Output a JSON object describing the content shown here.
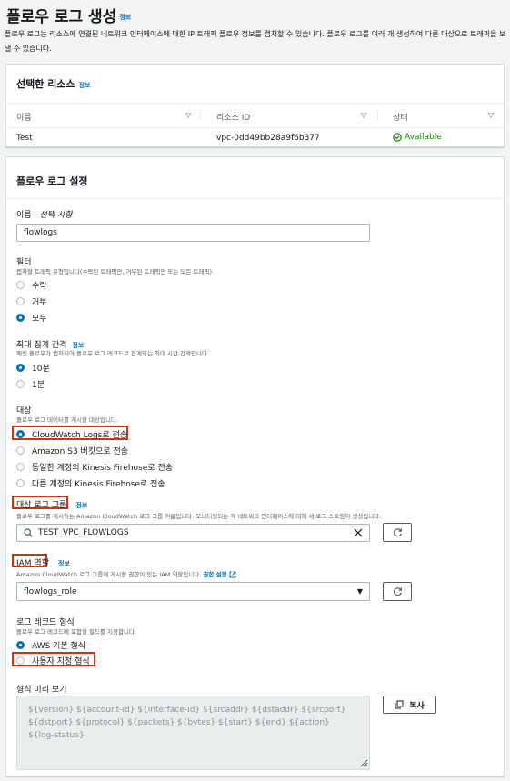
{
  "header": {
    "title": "플로우 로그 생성",
    "info": "정보",
    "description": "플로우 로그는 리소스에 연결된 네트워크 인터페이스에 대한 IP 트래픽 플로우 정보를 캡처할 수 있습니다. 플로우 로그를 여러 개 생성하여 다른 대상으로 트래픽을 보낼 수 있습니다."
  },
  "resources": {
    "title": "선택한 리소스",
    "info": "정보",
    "columns": [
      "이름",
      "리소스 ID",
      "상태"
    ],
    "row": {
      "name": "Test",
      "resource_id": "vpc-0dd49bb28a9f6b377",
      "status": "Available"
    }
  },
  "settings": {
    "title": "플로우 로그 설정",
    "name": {
      "label": "이름 -",
      "optional": "선택 사항",
      "value": "flowlogs"
    },
    "filter": {
      "label": "필터",
      "description": "캡처할 트래픽 유형입니다(수락된 트래픽만, 거부된 트래픽만 또는 모든 트래픽).",
      "options": [
        "수락",
        "거부",
        "모두"
      ],
      "selected": "모두"
    },
    "interval": {
      "label": "최대 집계 간격",
      "info": "정보",
      "description": "패킷 플로우가 캡처되어 플로우 로그 레코드로 집계되는 최대 시간 간격입니다.",
      "options": [
        "10분",
        "1분"
      ],
      "selected": "10분"
    },
    "destination": {
      "label": "대상",
      "description": "플로우 로그 데이터를 게시할 대상입니다.",
      "options": [
        "CloudWatch Logs로 전송",
        "Amazon S3 버킷으로 전송",
        "동일한 계정의 Kinesis Firehose로 전송",
        "다른 계정의 Kinesis Firehose로 전송"
      ],
      "selected": "CloudWatch Logs로 전송"
    },
    "log_group": {
      "label": "대상 로그 그룹",
      "info": "정보",
      "description": "플로우 로그를 게시하는 Amazon CloudWatch 로그 그룹 이름입니다. 모니터링되는 각 네트워크 인터페이스에 대해 새 로그 스트림이 생성됩니다.",
      "value": "TEST_VPC_FLOWLOGS"
    },
    "iam_role": {
      "label": "IAM 역할",
      "info": "정보",
      "description": "Amazon CloudWatch 로그 그룹에 게시할 권한이 있는 IAM 역할입니다.",
      "link": "권한 설정",
      "value": "flowlogs_role"
    },
    "record_format": {
      "label": "로그 레코드 형식",
      "description": "플로우 로그 레코드에 포함할 필드를 지정합니다.",
      "options": [
        "AWS 기본 형식",
        "사용자 지정 형식"
      ],
      "selected": "AWS 기본 형식"
    },
    "preview": {
      "label": "형식 미리 보기",
      "text": "${version} ${account-id} ${interface-id} ${srcaddr} ${dstaddr} ${srcport} ${dstport} ${protocol} ${packets} ${bytes} ${start} ${end} ${action} ${log-status}",
      "copy_label": "복사"
    }
  },
  "colors": {
    "accent": "#0073bb",
    "highlight": "#d13212",
    "success": "#1d8102"
  }
}
